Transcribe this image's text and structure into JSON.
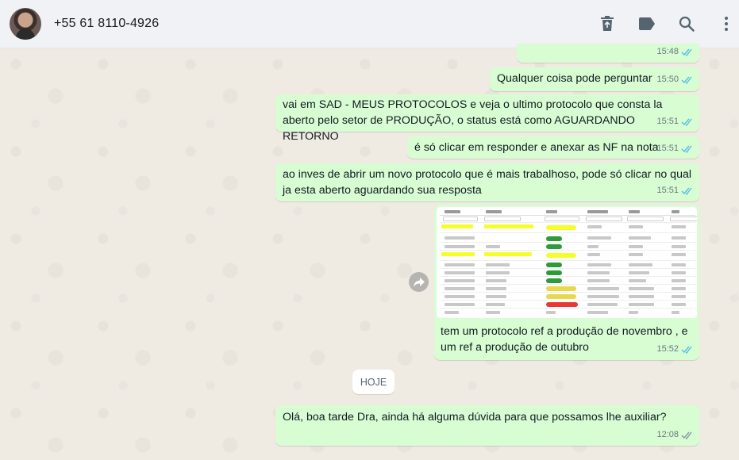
{
  "header": {
    "contact_name": "+55 61 8110-4926",
    "icons": [
      "delete-icon",
      "label-icon",
      "search-icon",
      "menu-icon"
    ]
  },
  "messages": [
    {
      "text": "",
      "time": "15:48",
      "status": "read"
    },
    {
      "text": "Qualquer coisa pode perguntar",
      "time": "15:50",
      "status": "read"
    },
    {
      "text": "vai em SAD - MEUS PROTOCOLOS e veja o ultimo protocolo que consta la aberto pelo setor de PRODUÇÃO, o status está como AGUARDANDO RETORNO",
      "time": "15:51",
      "status": "read"
    },
    {
      "text": "é só clicar em responder e anexar as NF na nota",
      "time": "15:51",
      "status": "read"
    },
    {
      "text": "ao inves de abrir um novo protocolo que é mais trabalhoso, pode só clicar no qual ja esta aberto aguardando sua resposta",
      "time": "15:51",
      "status": "read"
    },
    {
      "text": "tem um protocolo ref a produção de novembro , e um ref a produção de outubro",
      "time": "15:52",
      "status": "read",
      "has_image": true
    },
    {
      "text": "Olá, boa tarde Dra, ainda há alguma dúvida para que possamos lhe auxiliar?",
      "time": "12:08",
      "status": "delivered"
    }
  ],
  "day_divider": "HOJE",
  "colors": {
    "outgoing_bubble": "#d9fdd3",
    "read_ticks": "#53bdeb",
    "delivered_ticks": "#8696a0",
    "header_bg": "#f0f2f5",
    "chat_bg": "#efeae2"
  }
}
